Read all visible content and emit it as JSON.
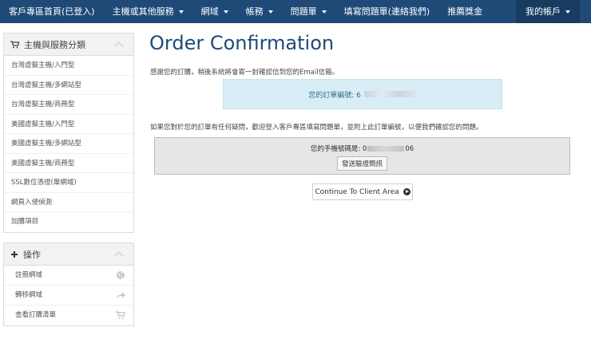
{
  "nav": {
    "items": [
      {
        "label": "客戶專區首頁(已登入)",
        "caret": false
      },
      {
        "label": "主機或其他服務",
        "caret": true
      },
      {
        "label": "網域",
        "caret": true
      },
      {
        "label": "帳務",
        "caret": true
      },
      {
        "label": "問題單",
        "caret": true
      },
      {
        "label": "填寫問題單(連絡我們)",
        "caret": false
      },
      {
        "label": "推薦獎金",
        "caret": false
      }
    ],
    "account_label": "我的帳戶"
  },
  "sidebar": {
    "categories": {
      "title": "主機與服務分類",
      "items": [
        "台灣虛擬主機/入門型",
        "台灣虛擬主機/多網站型",
        "台灣虛擬主機/商務型",
        "美國虛擬主機/入門型",
        "美國虛擬主機/多網站型",
        "美國虛擬主機/商務型",
        "SSL數位憑證(單網域)",
        "網頁入侵偵測",
        "加購項目"
      ]
    },
    "actions": {
      "title": "操作",
      "items": [
        {
          "label": "註冊網域",
          "icon": "globe-icon"
        },
        {
          "label": "轉移網域",
          "icon": "share-arrow-icon"
        },
        {
          "label": "查看訂購清單",
          "icon": "cart-icon"
        }
      ]
    }
  },
  "main": {
    "title": "Order Confirmation",
    "thanks_text": "感謝您的訂購，稍後系統將會寄一封確認信到您的Email信箱。",
    "order_number_label": "您的訂單編號: 6",
    "question_text": "如果您對於您的訂單有任何疑問，歡迎登入客戶專區填寫問題單，並附上此訂單編號，以便我們確認您的問題。",
    "phone_label_prefix": "您的手機號碼是: 0",
    "phone_label_suffix": "06",
    "send_button": "發送驗證簡訊",
    "continue_button": "Continue To Client Area"
  },
  "colors": {
    "nav_bg": "#1f4a78",
    "title": "#1f4a78",
    "info_bg": "#d9edf7"
  }
}
